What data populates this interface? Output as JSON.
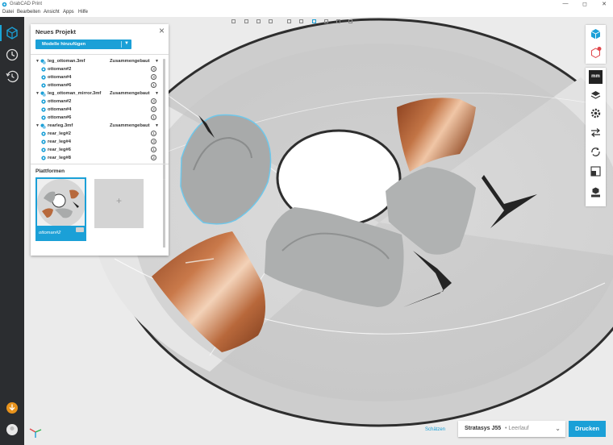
{
  "window": {
    "title": "GrabCAD Print",
    "controls": [
      "—",
      "◻",
      "✕"
    ]
  },
  "menu": [
    "Datei",
    "Bearbeiten",
    "Ansicht",
    "Apps",
    "Hilfe"
  ],
  "panel": {
    "title": "Neues Projekt",
    "add_models_label": "Modelle hinzufügen",
    "tree": [
      {
        "kind": "group",
        "name": "leg_ottoman.3mf",
        "status": "Zusammengebaut"
      },
      {
        "kind": "item",
        "name": "ottoman#2",
        "count": "3"
      },
      {
        "kind": "item",
        "name": "ottoman#4",
        "count": "3"
      },
      {
        "kind": "item",
        "name": "ottoman#6",
        "count": "1"
      },
      {
        "kind": "group",
        "name": "leg_ottoman_mirror.3mf",
        "status": "Zusammengebaut"
      },
      {
        "kind": "item",
        "name": "ottoman#2",
        "count": "3"
      },
      {
        "kind": "item",
        "name": "ottoman#4",
        "count": "2"
      },
      {
        "kind": "item",
        "name": "ottoman#6",
        "count": "1"
      },
      {
        "kind": "group",
        "name": "rearleg.3mf",
        "status": "Zusammengebaut"
      },
      {
        "kind": "item",
        "name": "rear_leg#2",
        "count": "1"
      },
      {
        "kind": "item",
        "name": "rear_leg#4",
        "count": "3"
      },
      {
        "kind": "item",
        "name": "rear_leg#6",
        "count": "1"
      },
      {
        "kind": "item",
        "name": "rear_leg#8",
        "count": "2"
      }
    ],
    "platforms_title": "Plattformen",
    "platform_name": "ottoman#2",
    "add_platform_symbol": "+"
  },
  "bottom": {
    "estimate_label": "Schätzen",
    "printer_name": "Stratasys J55",
    "printer_status": "• Leerlauf",
    "print_label": "Drucken"
  },
  "right_toolbar": {
    "units_label": "mm",
    "icons": [
      "cube-view-icon",
      "cube-alert-icon",
      "units-icon",
      "layers-icon",
      "settings-gear-icon",
      "move-icon",
      "rotate-icon",
      "scale-icon",
      "tray-icon"
    ]
  },
  "colors": {
    "accent": "#1ba0d7",
    "sidebar": "#2b2d30",
    "wood": "#b5663a",
    "grey_part": "#a9abab"
  }
}
